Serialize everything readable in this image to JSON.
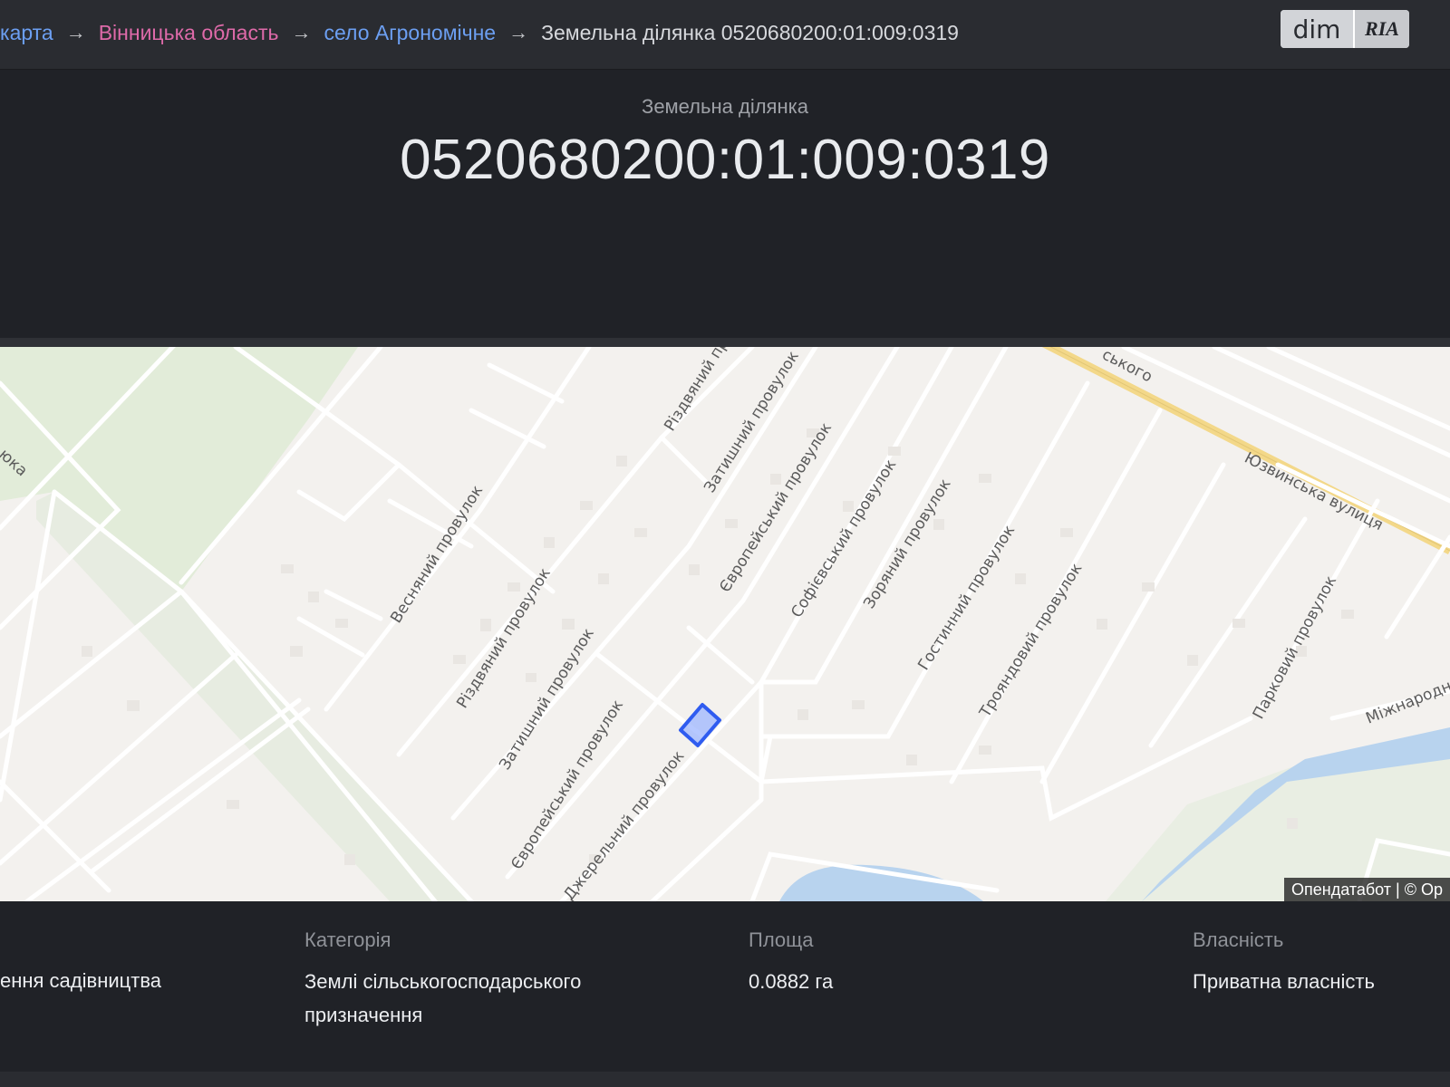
{
  "breadcrumb": {
    "items": [
      {
        "label": "карта",
        "kind": "link-blue"
      },
      {
        "label": "Вінницька область",
        "kind": "link-pink"
      },
      {
        "label": "село Агрономічне",
        "kind": "link-blue"
      },
      {
        "label": "Земельна ділянка 0520680200:01:009:0319",
        "kind": "current"
      }
    ],
    "separator": "→"
  },
  "logo": {
    "left": "dim",
    "right": "RIA"
  },
  "header": {
    "kicker": "Земельна ділянка",
    "title": "0520680200:01:009:0319"
  },
  "map": {
    "attribution": "Опендатабот | © Op",
    "street_labels": [
      "Весняний провулок",
      "Різдвяний провулок",
      "Затишний провулок",
      "Європейський провулок",
      "Джерельний провулок",
      "Різдвяний пр",
      "Затишний провулок",
      "Європейський провулок",
      "Софієвський провулок",
      "Зоряний провулок",
      "Гостинний провулок",
      "Трояндовий провулок",
      "Парковий провулок",
      "Юзвинська вулиця",
      "Міжнародн",
      "ського",
      "юка"
    ]
  },
  "info": {
    "purpose_value": "ення садівництва",
    "category": {
      "label": "Категорія",
      "value": "Землі сільськогосподарського призначення"
    },
    "area": {
      "label": "Площа",
      "value": "0.0882 га"
    },
    "ownership": {
      "label": "Власність",
      "value": "Приватна власність"
    }
  },
  "colors": {
    "accent_blue": "#6c9ff2",
    "accent_pink": "#de6aa9",
    "parcel_stroke": "#2f5cf0",
    "parcel_fill": "#9db5ff"
  }
}
